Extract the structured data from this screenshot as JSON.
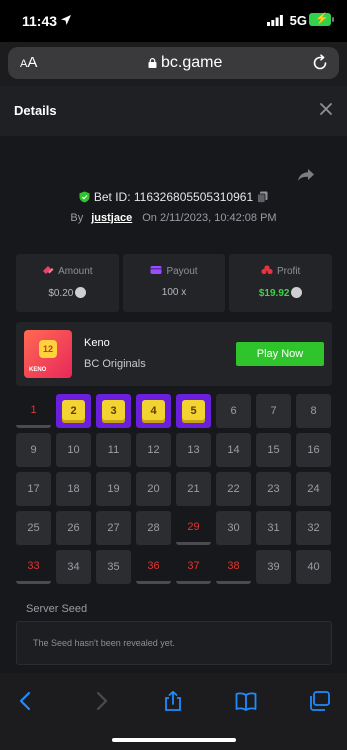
{
  "status_bar": {
    "time": "11:43",
    "network": "5G"
  },
  "browser": {
    "text_size_label_small": "A",
    "text_size_label_large": "A",
    "url": "bc.game"
  },
  "details": {
    "title": "Details",
    "bet_id": "Bet ID: 116326805505310961",
    "by_label": "By",
    "username": "justjace",
    "on_label": "On",
    "timestamp": "2/11/2023, 10:42:08 PM"
  },
  "stats": {
    "amount_label": "Amount",
    "amount_value": "$0.20",
    "payout_label": "Payout",
    "payout_value": "100 x",
    "profit_label": "Profit",
    "profit_value": "$19.92"
  },
  "game": {
    "thumb_number": "12",
    "thumb_text": "KENO",
    "name": "Keno",
    "provider": "BC Originals",
    "play_button": "Play Now"
  },
  "keno_board": {
    "cells": [
      "1",
      "2",
      "3",
      "4",
      "5",
      "6",
      "7",
      "8",
      "9",
      "10",
      "11",
      "12",
      "13",
      "14",
      "15",
      "16",
      "17",
      "18",
      "19",
      "20",
      "21",
      "22",
      "23",
      "24",
      "25",
      "26",
      "27",
      "28",
      "29",
      "30",
      "31",
      "32",
      "33",
      "34",
      "35",
      "36",
      "37",
      "38",
      "39",
      "40"
    ],
    "states": [
      "miss",
      "hit",
      "hit",
      "hit",
      "hit",
      "",
      "",
      "",
      "",
      "",
      "",
      "",
      "",
      "",
      "",
      "",
      "",
      "",
      "",
      "",
      "",
      "",
      "",
      "",
      "",
      "",
      "",
      "",
      "miss",
      "",
      "",
      "",
      "miss",
      "",
      "",
      "miss",
      "miss",
      "miss",
      "",
      ""
    ]
  },
  "seed": {
    "label": "Server Seed",
    "message": "The Seed hasn't been revealed yet."
  },
  "colors": {
    "accent_green": "#2fc42b",
    "hit_purple": "#6a1fdc",
    "miss_red": "#e3352e",
    "profit_green": "#3dd34a"
  }
}
